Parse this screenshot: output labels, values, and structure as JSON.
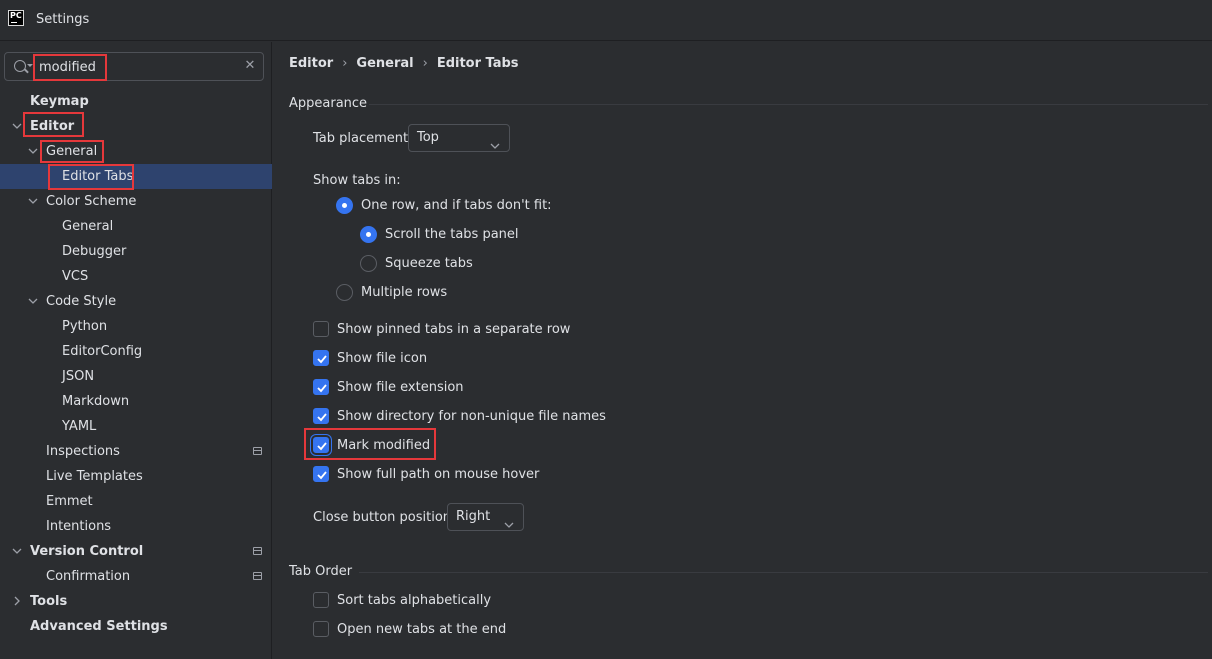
{
  "window": {
    "title": "Settings",
    "logo_text": "PC"
  },
  "search": {
    "value": "modified",
    "clear_icon": "close-icon"
  },
  "tree": {
    "keymap": "Keymap",
    "editor": "Editor",
    "general": "General",
    "editor_tabs": "Editor Tabs",
    "color_scheme": "Color Scheme",
    "cs_general": "General",
    "cs_debugger": "Debugger",
    "cs_vcs": "VCS",
    "code_style": "Code Style",
    "python": "Python",
    "editorconfig": "EditorConfig",
    "json": "JSON",
    "markdown": "Markdown",
    "yaml": "YAML",
    "inspections": "Inspections",
    "live_templates": "Live Templates",
    "emmet": "Emmet",
    "intentions": "Intentions",
    "version_control": "Version Control",
    "confirmation": "Confirmation",
    "tools": "Tools",
    "advanced_settings": "Advanced Settings"
  },
  "breadcrumb": [
    "Editor",
    "General",
    "Editor Tabs"
  ],
  "appearance": {
    "title": "Appearance",
    "tab_placement_label": "Tab placement:",
    "tab_placement_value": "Top",
    "show_tabs_in_label": "Show tabs in:",
    "one_row": "One row, and if tabs don't fit:",
    "scroll_panel": "Scroll the tabs panel",
    "squeeze_tabs": "Squeeze tabs",
    "multiple_rows": "Multiple rows",
    "pinned_tabs": "Show pinned tabs in a separate row",
    "file_icon": "Show file icon",
    "file_extension": "Show file extension",
    "directory_names": "Show directory for non-unique file names",
    "mark_modified": "Mark modified",
    "full_path": "Show full path on mouse hover",
    "close_button_label": "Close button position:",
    "close_button_value": "Right"
  },
  "tab_order": {
    "title": "Tab Order",
    "sort_alpha": "Sort tabs alphabetically",
    "open_at_end": "Open new tabs at the end"
  },
  "colors": {
    "accent": "#3574f0",
    "highlight": "#e5383b",
    "selection": "#2e436e",
    "background": "#2b2d30"
  }
}
